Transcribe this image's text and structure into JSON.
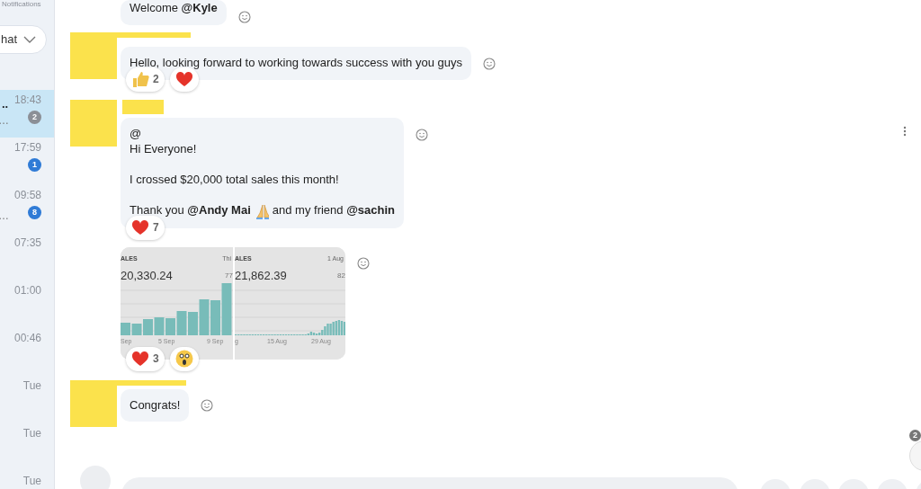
{
  "sidebar": {
    "header": "Notifications",
    "filter": "hat",
    "conversations": [
      {
        "title": "..",
        "snippet": "…",
        "time": "18:43",
        "unread": "2",
        "muted": true,
        "selected": true
      },
      {
        "time": "17:59",
        "unread": "1",
        "muted": false,
        "selected": false
      },
      {
        "snippet": "…",
        "time": "09:58",
        "unread": "8",
        "muted": false,
        "selected": false
      },
      {
        "time": "07:35",
        "selected": false
      },
      {
        "time": "01:00",
        "selected": false
      },
      {
        "time": "00:46",
        "selected": false
      },
      {
        "time": "Tue",
        "selected": false
      },
      {
        "time": "Tue",
        "selected": false
      },
      {
        "time": "Tue",
        "selected": false
      }
    ]
  },
  "messages": [
    {
      "kind": "text",
      "paragraphs": [
        [
          "Welcome **@Kyle**"
        ]
      ]
    },
    {
      "kind": "text",
      "paragraphs": [
        [
          "Hello, looking forward to working towards success with you guys"
        ]
      ],
      "reactions": [
        {
          "kind": "thumbs-up",
          "count": "2"
        },
        {
          "kind": "heart"
        }
      ]
    },
    {
      "kind": "text",
      "paragraphs": [
        [
          "@",
          "Hi Everyone!"
        ],
        [
          "I crossed $20,000 total sales this month!"
        ],
        [
          {
            "parts": [
              "Thank you **@Andy Mai**",
              "and my friend **@sachin**"
            ]
          }
        ]
      ],
      "reactions": [
        {
          "kind": "heart",
          "count": "7"
        }
      ]
    },
    {
      "kind": "image",
      "panels": [
        {
          "label": "ALES",
          "corner": "Thi",
          "value": "20,330.24",
          "sub": "77",
          "ticks": [
            "Sep",
            "5 Sep",
            "9 Sep"
          ]
        },
        {
          "label": "ALES",
          "corner": "1 Aug",
          "value": "21,862.39",
          "sub": "82",
          "ticks": [
            "g",
            "15 Aug",
            "29 Aug"
          ]
        }
      ],
      "reactions": [
        {
          "kind": "heart",
          "count": "3"
        },
        {
          "kind": "astonished"
        }
      ]
    },
    {
      "kind": "text",
      "paragraphs": [
        [
          "Congrats!"
        ]
      ]
    }
  ],
  "scroll_button": {
    "unread": "2"
  }
}
